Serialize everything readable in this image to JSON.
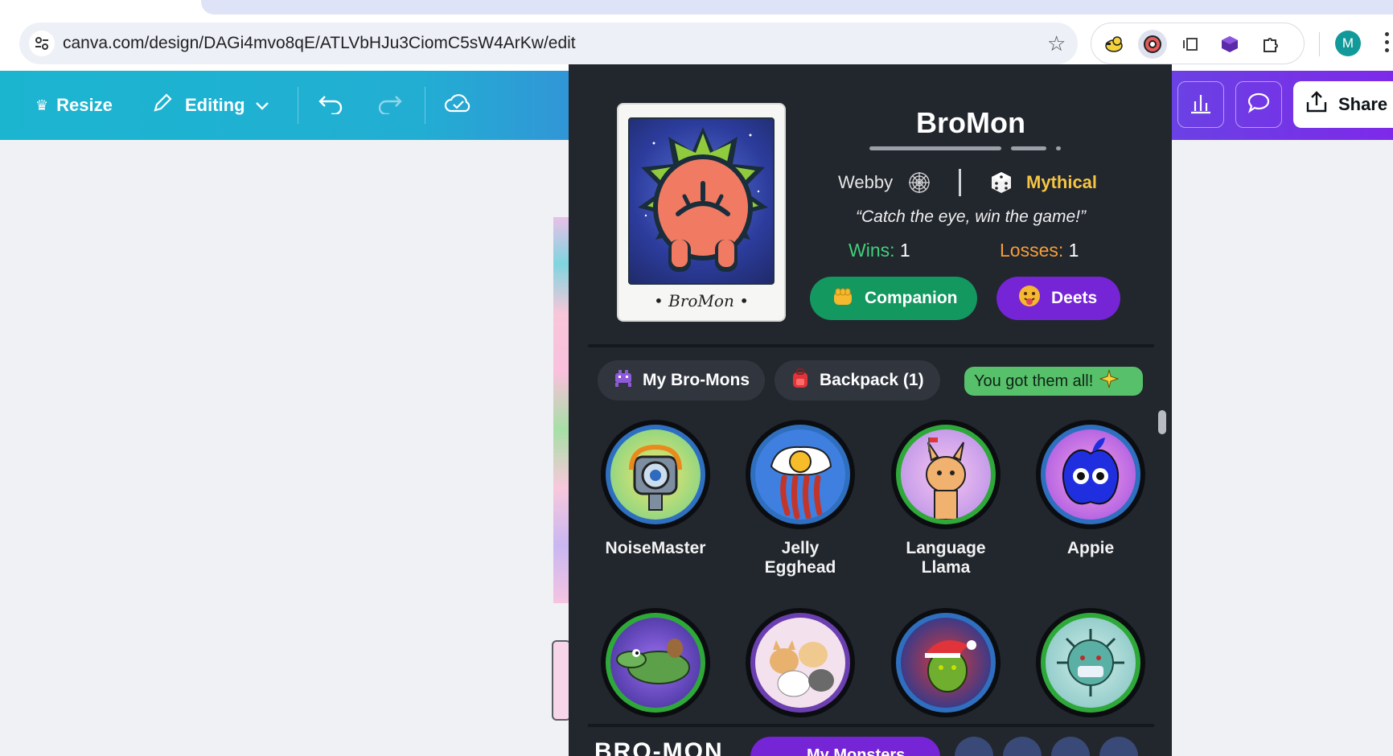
{
  "browser": {
    "url": "canva.com/design/DAGi4mvo8qE/ATLVbHJu3CiomC5sW4ArKw/edit",
    "profile_initial": "M"
  },
  "canva": {
    "resize_label": "Resize",
    "editing_label": "Editing",
    "share_label": "Share"
  },
  "popup": {
    "mon_name": "BroMon",
    "card_caption": "• BroMon •",
    "type": "Webby",
    "rarity": "Mythical",
    "quote": "“Catch the eye, win the game!”",
    "wins_label": "Wins:",
    "wins_value": "1",
    "losses_label": "Losses:",
    "losses_value": "1",
    "companion_label": "Companion",
    "deets_label": "Deets",
    "tabs": {
      "my_bromons": "My Bro-Mons",
      "backpack": "Backpack (1)"
    },
    "got_all_label": "You got them all!",
    "monsters": [
      {
        "name": "NoiseMaster",
        "ring": "#2f6fbf"
      },
      {
        "name": "Jelly\nEgghead",
        "ring": "#2f6fbf"
      },
      {
        "name": "Language\nLlama",
        "ring": "#2fa83a"
      },
      {
        "name": "Appie",
        "ring": "#2f6fbf"
      },
      {
        "name": "",
        "ring": "#2fa83a"
      },
      {
        "name": "",
        "ring": "#6b3fb0"
      },
      {
        "name": "",
        "ring": "#2f6fbf"
      },
      {
        "name": "",
        "ring": "#2fa83a"
      }
    ],
    "footer": {
      "logo": "BRO-MON",
      "my_monsters": "My Monsters"
    }
  }
}
